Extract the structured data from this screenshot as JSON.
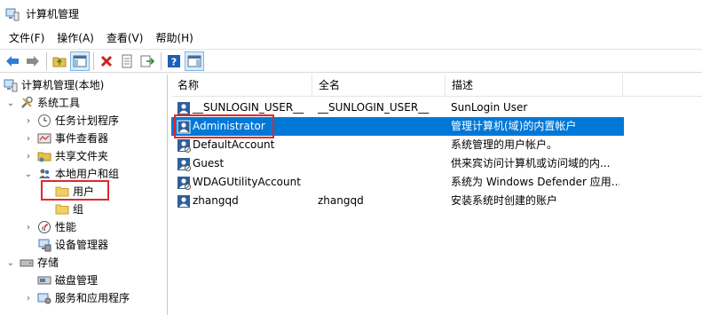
{
  "window": {
    "title": "计算机管理"
  },
  "menu": [
    "文件(F)",
    "操作(A)",
    "查看(V)",
    "帮助(H)"
  ],
  "toolbar": {
    "buttons": [
      "back-icon",
      "forward-icon",
      "up-folder-icon",
      "show-hide-tree-icon",
      "delete-icon",
      "properties-icon",
      "export-icon",
      "help-icon",
      "action-pane-icon"
    ]
  },
  "tree": {
    "root": "计算机管理(本地)",
    "system_tools": "系统工具",
    "task_scheduler": "任务计划程序",
    "event_viewer": "事件查看器",
    "shared_folders": "共享文件夹",
    "local_users": "本地用户和组",
    "users": "用户",
    "groups": "组",
    "performance": "性能",
    "device_manager": "设备管理器",
    "storage": "存储",
    "disk_management": "磁盘管理",
    "services_apps": "服务和应用程序"
  },
  "list": {
    "columns": [
      "名称",
      "全名",
      "描述"
    ],
    "rows": [
      {
        "name": "__SUNLOGIN_USER__",
        "fullname": "__SUNLOGIN_USER__",
        "desc": "SunLogin User"
      },
      {
        "name": "Administrator",
        "fullname": "",
        "desc": "管理计算机(域)的内置帐户"
      },
      {
        "name": "DefaultAccount",
        "fullname": "",
        "desc": "系统管理的用户帐户。"
      },
      {
        "name": "Guest",
        "fullname": "",
        "desc": "供来宾访问计算机或访问域的内..."
      },
      {
        "name": "WDAGUtilityAccount",
        "fullname": "",
        "desc": "系统为 Windows Defender 应用..."
      },
      {
        "name": "zhangqd",
        "fullname": "zhangqd",
        "desc": "安装系统时创建的账户"
      }
    ],
    "selected_index": 1
  },
  "colors": {
    "selection": "#0078d7",
    "annotation": "#e0282e"
  }
}
